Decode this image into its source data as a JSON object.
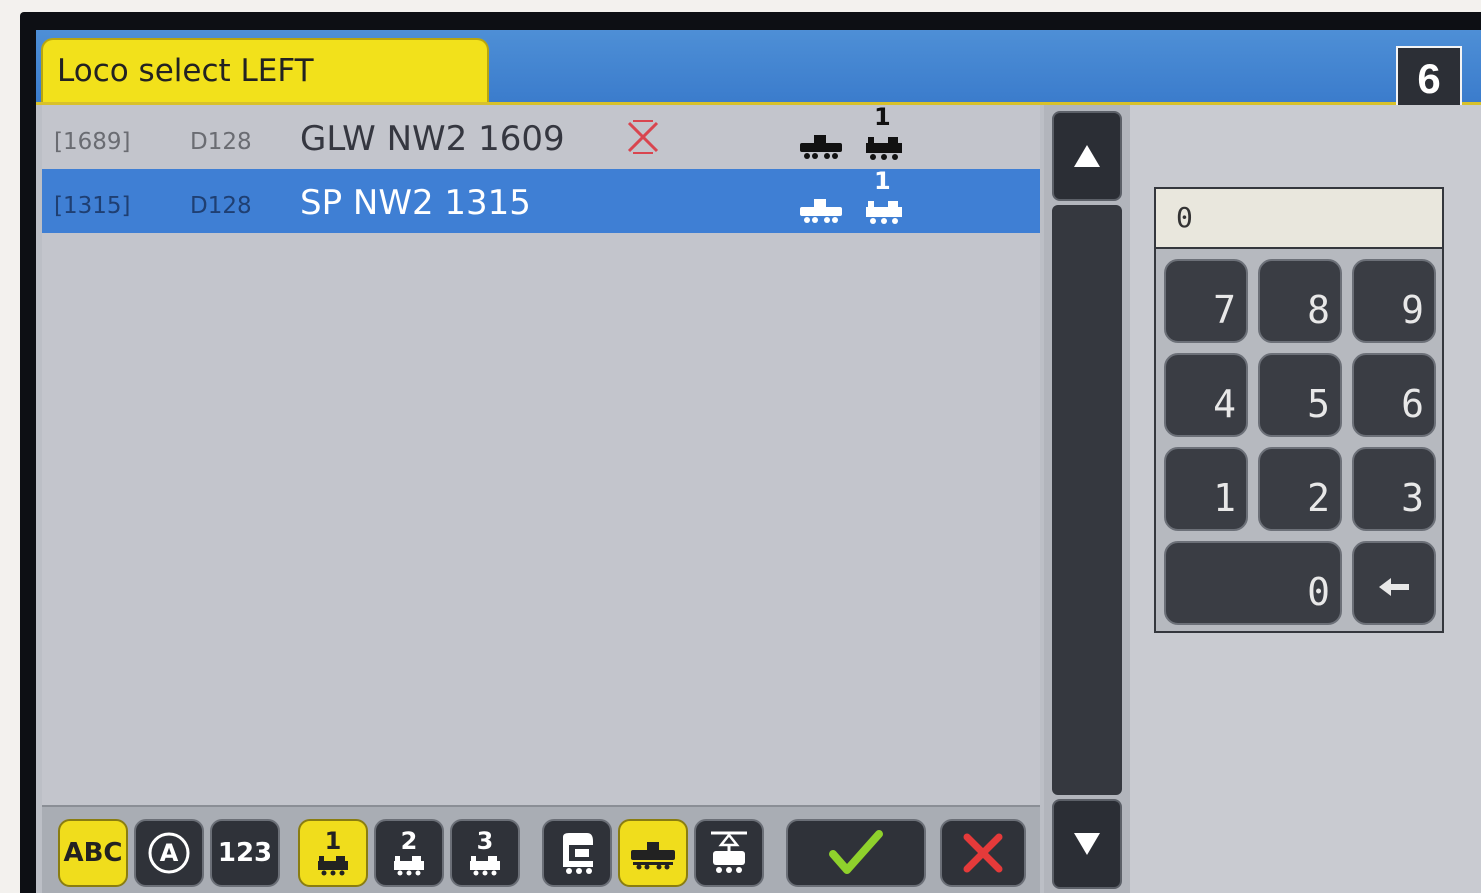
{
  "header": {
    "tab_title": "Loco select LEFT",
    "step_badge": "6"
  },
  "loco_list": [
    {
      "address": "[1689]",
      "protocol": "D128",
      "name": "GLW NW2 1609",
      "marked_x": true,
      "consist_number": "1",
      "selected": false
    },
    {
      "address": "[1315]",
      "protocol": "D128",
      "name": "SP NW2 1315",
      "marked_x": false,
      "consist_number": "1",
      "selected": true
    }
  ],
  "scroll": {
    "up_icon": "triangle-up-icon",
    "down_icon": "triangle-down-icon"
  },
  "number_input": {
    "value": "0"
  },
  "keypad": {
    "keys": [
      "7",
      "8",
      "9",
      "4",
      "5",
      "6",
      "1",
      "2",
      "3",
      "0"
    ],
    "backspace_icon": "arrow-left-icon"
  },
  "toolbar": {
    "abc_label": "ABC",
    "a_label": "A",
    "num_label": "123",
    "consist_1": "1",
    "consist_2": "2",
    "consist_3": "3",
    "confirm_icon": "checkmark-icon",
    "cancel_icon": "x-icon"
  },
  "colors": {
    "accent_yellow": "#f0dd1c",
    "selection_blue": "#3f7fd4",
    "header_blue": "#4e8fd6",
    "confirm_green": "#8fd12c",
    "cancel_red": "#e53a3a"
  }
}
